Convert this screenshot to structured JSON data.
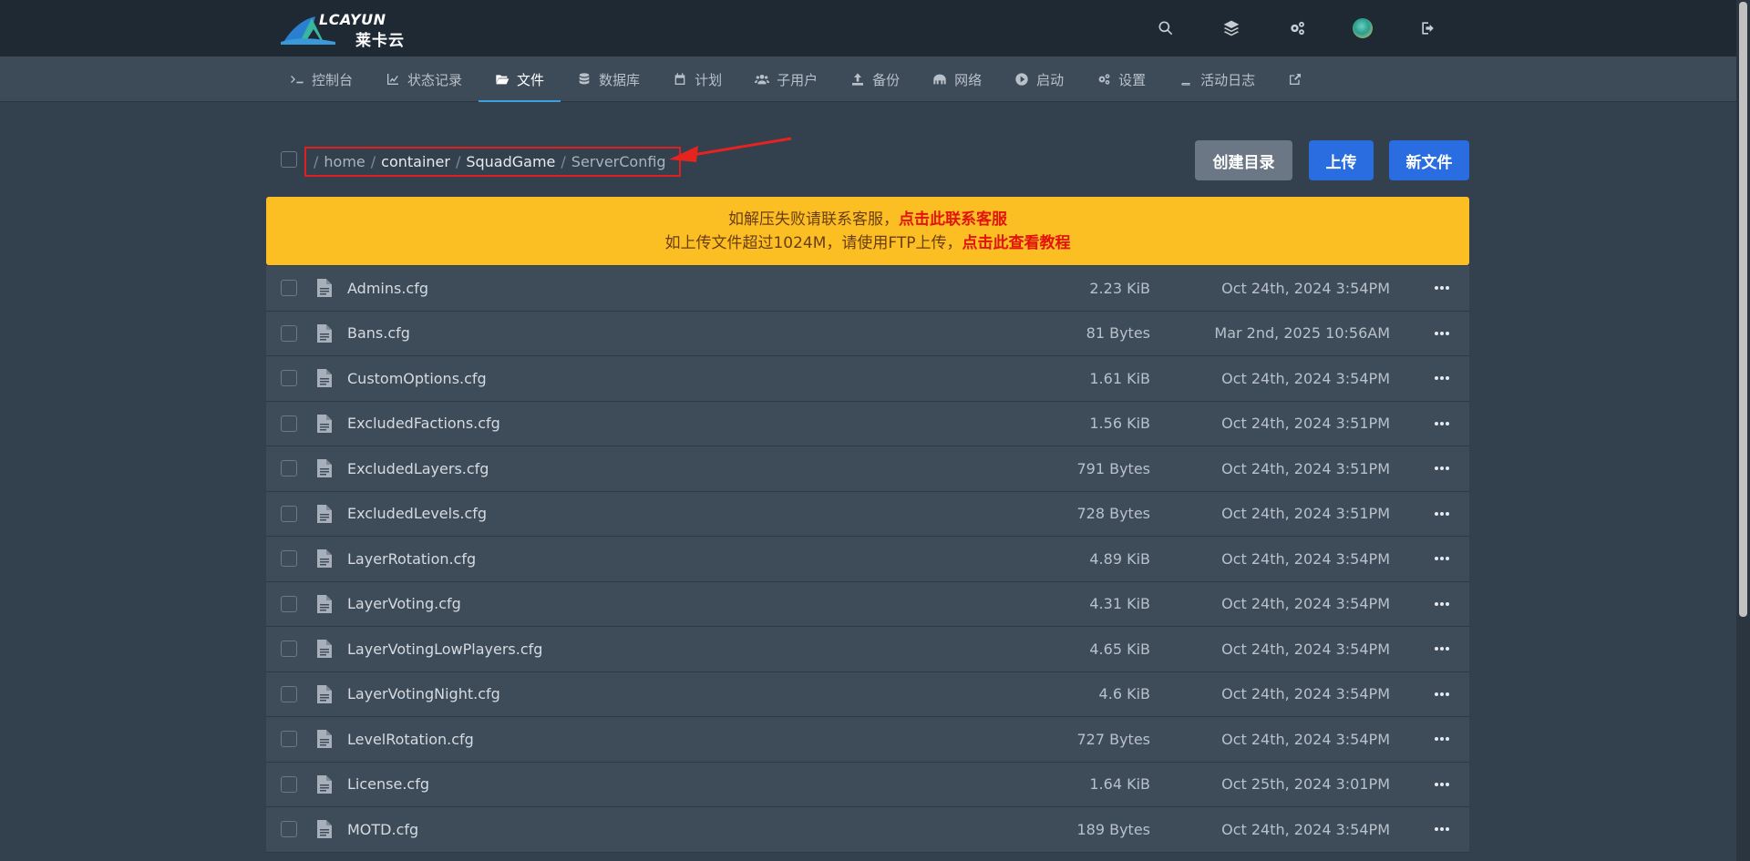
{
  "logo": {
    "text_top": "LCAYUN",
    "text_bottom": "莱卡云"
  },
  "topbar": {
    "icons": [
      "search-icon",
      "layers-icon",
      "cogs-icon",
      "avatar",
      "logout-icon"
    ]
  },
  "nav": [
    {
      "label": "控制台",
      "icon": "terminal-icon",
      "active": false
    },
    {
      "label": "状态记录",
      "icon": "chart-line-icon",
      "active": false
    },
    {
      "label": "文件",
      "icon": "folder-open-icon",
      "active": true
    },
    {
      "label": "数据库",
      "icon": "database-icon",
      "active": false
    },
    {
      "label": "计划",
      "icon": "calendar-icon",
      "active": false
    },
    {
      "label": "子用户",
      "icon": "users-icon",
      "active": false
    },
    {
      "label": "备份",
      "icon": "upload-icon",
      "active": false
    },
    {
      "label": "网络",
      "icon": "network-icon",
      "active": false
    },
    {
      "label": "启动",
      "icon": "play-circle-icon",
      "active": false
    },
    {
      "label": "设置",
      "icon": "cogs-icon",
      "active": false
    },
    {
      "label": "活动日志",
      "icon": "book-icon",
      "active": false
    },
    {
      "label": "",
      "icon": "external-link-icon",
      "active": false
    }
  ],
  "breadcrumb": {
    "sep": "/",
    "parts": [
      "home",
      "container",
      "SquadGame",
      "ServerConfig"
    ]
  },
  "buttons": {
    "mkdir": "创建目录",
    "upload": "上传",
    "newfile": "新文件"
  },
  "notice": {
    "line1_text": "如解压失败请联系客服，",
    "line1_link": "点击此联系客服",
    "line2_text": "如上传文件超过1024M，请使用FTP上传，",
    "line2_link": "点击此查看教程"
  },
  "files": [
    {
      "name": "Admins.cfg",
      "size": "2.23 KiB",
      "date": "Oct 24th, 2024 3:54PM"
    },
    {
      "name": "Bans.cfg",
      "size": "81 Bytes",
      "date": "Mar 2nd, 2025 10:56AM"
    },
    {
      "name": "CustomOptions.cfg",
      "size": "1.61 KiB",
      "date": "Oct 24th, 2024 3:54PM"
    },
    {
      "name": "ExcludedFactions.cfg",
      "size": "1.56 KiB",
      "date": "Oct 24th, 2024 3:51PM"
    },
    {
      "name": "ExcludedLayers.cfg",
      "size": "791 Bytes",
      "date": "Oct 24th, 2024 3:51PM"
    },
    {
      "name": "ExcludedLevels.cfg",
      "size": "728 Bytes",
      "date": "Oct 24th, 2024 3:51PM"
    },
    {
      "name": "LayerRotation.cfg",
      "size": "4.89 KiB",
      "date": "Oct 24th, 2024 3:54PM"
    },
    {
      "name": "LayerVoting.cfg",
      "size": "4.31 KiB",
      "date": "Oct 24th, 2024 3:54PM"
    },
    {
      "name": "LayerVotingLowPlayers.cfg",
      "size": "4.65 KiB",
      "date": "Oct 24th, 2024 3:54PM"
    },
    {
      "name": "LayerVotingNight.cfg",
      "size": "4.6 KiB",
      "date": "Oct 24th, 2024 3:54PM"
    },
    {
      "name": "LevelRotation.cfg",
      "size": "727 Bytes",
      "date": "Oct 24th, 2024 3:54PM"
    },
    {
      "name": "License.cfg",
      "size": "1.64 KiB",
      "date": "Oct 25th, 2024 3:01PM"
    },
    {
      "name": "MOTD.cfg",
      "size": "189 Bytes",
      "date": "Oct 24th, 2024 3:54PM"
    }
  ]
}
